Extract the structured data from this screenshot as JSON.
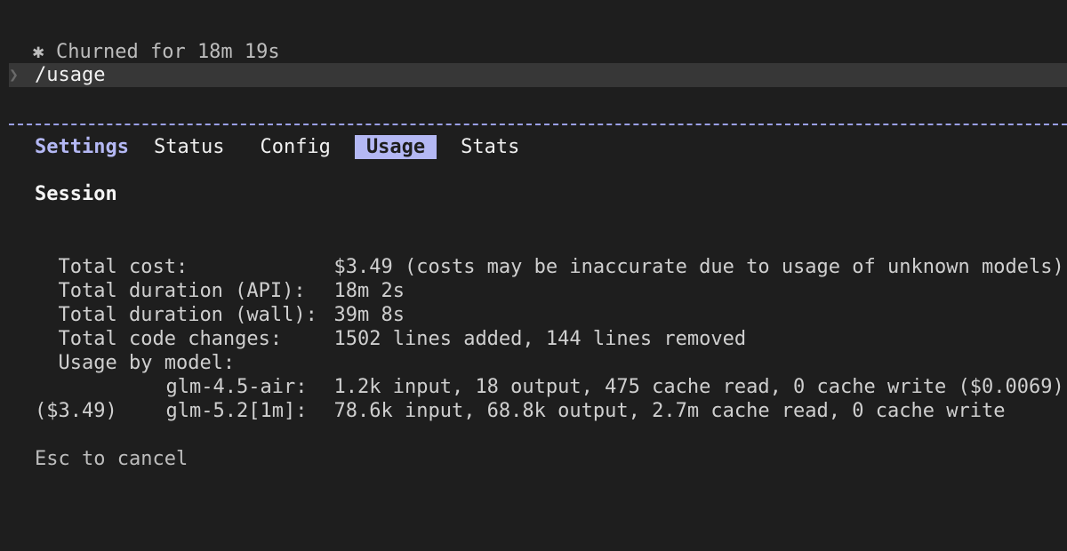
{
  "status": {
    "spinner_glyph": "✱",
    "text": "Churned for 18m 19s"
  },
  "prompt": {
    "caret": "❯",
    "command": "/usage"
  },
  "tabs": {
    "title": "Settings",
    "items": [
      {
        "label": "Status",
        "active": false
      },
      {
        "label": "Config",
        "active": false
      },
      {
        "label": "Usage",
        "active": true
      },
      {
        "label": "Stats",
        "active": false
      }
    ]
  },
  "session": {
    "title": "Session",
    "rows": [
      {
        "label": "Total cost:",
        "value": "$3.49 (costs may be inaccurate due to usage of unknown models)"
      },
      {
        "label": "Total duration (API):",
        "value": "18m 2s"
      },
      {
        "label": "Total duration (wall):",
        "value": "39m 8s"
      },
      {
        "label": "Total code changes:",
        "value": "1502 lines added, 144 lines removed"
      },
      {
        "label": "Usage by model:",
        "value": ""
      }
    ],
    "models": [
      {
        "name": "glm-4.5-air:",
        "value": "1.2k input, 18 output, 475 cache read, 0 cache write ($0.0069)"
      },
      {
        "name": "glm-5.2[1m]:",
        "value": "78.6k input, 68.8k output, 2.7m cache read, 0 cache write"
      }
    ],
    "model_wrap": "($3.49)"
  },
  "hint": "Esc to cancel",
  "colors": {
    "background": "#1e1e1e",
    "accent": "#b4b8f4",
    "prompt_bar": "#373737",
    "divider": "#9a9fe6"
  }
}
